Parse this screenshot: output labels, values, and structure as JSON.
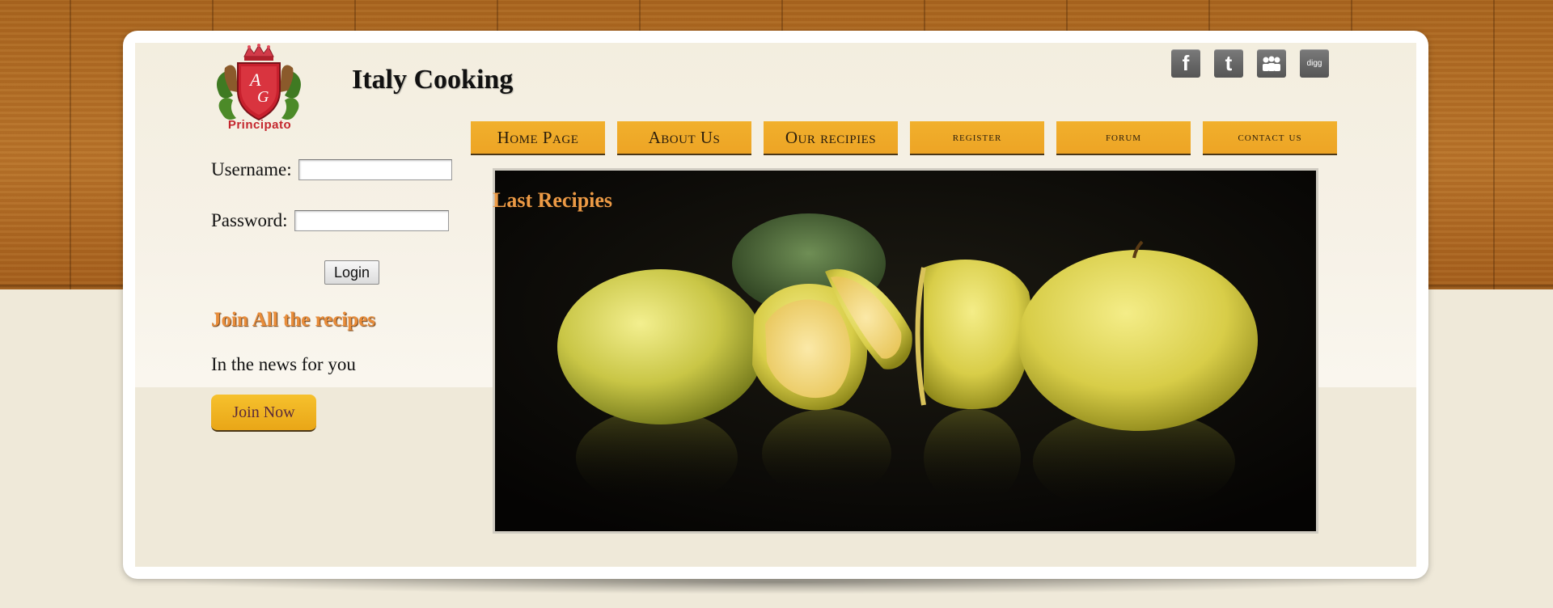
{
  "header": {
    "site_title": "Italy Cooking",
    "logo_text": "Principato",
    "logo_monogram": "AG"
  },
  "social": [
    {
      "icon": "facebook-icon",
      "glyph": "f"
    },
    {
      "icon": "twitter-icon",
      "glyph": "t"
    },
    {
      "icon": "myspace-icon",
      "glyph": "👥"
    },
    {
      "icon": "digg-icon",
      "glyph": "digg"
    }
  ],
  "nav": {
    "items": [
      "Home Page",
      "About Us",
      "Our recipies",
      "register",
      "forum",
      "contact us"
    ]
  },
  "login": {
    "username_label": "Username:",
    "password_label": "Password:",
    "username_value": "",
    "password_value": "",
    "button_label": "Login"
  },
  "sidebar": {
    "join_title": "Join All the recipes",
    "news_text": "In the news for you",
    "join_button": "Join Now"
  },
  "main": {
    "section_title": "Last Recipies",
    "image_alt": "Green apples on a dark reflective table"
  },
  "colors": {
    "accent_orange": "#e98d3a",
    "nav_gold": "#f1b02c",
    "wood": "#b8732a",
    "background": "#efe9d9"
  }
}
